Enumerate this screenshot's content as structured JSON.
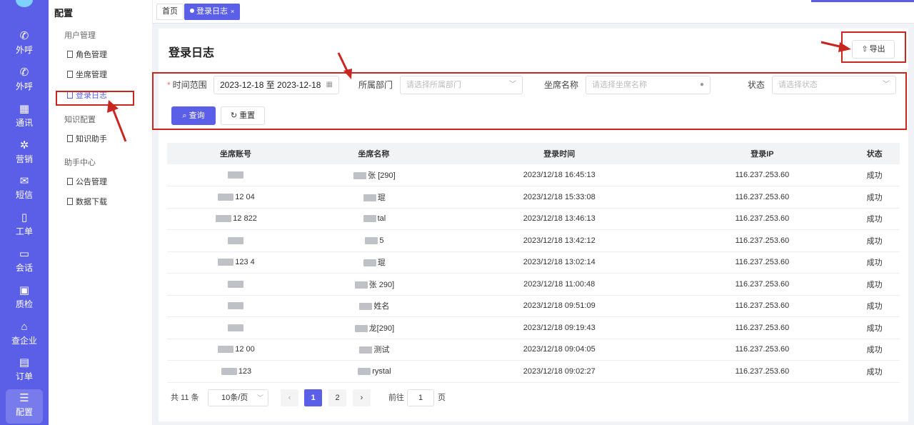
{
  "rail": {
    "items": [
      {
        "label": "外呼",
        "icon": "phone-outgoing-icon"
      },
      {
        "label": "外呼",
        "icon": "phone-outgoing-icon"
      },
      {
        "label": "通讯",
        "icon": "contacts-icon"
      },
      {
        "label": "营销",
        "icon": "marketing-icon"
      },
      {
        "label": "短信",
        "icon": "sms-icon"
      },
      {
        "label": "工单",
        "icon": "clipboard-icon"
      },
      {
        "label": "会话",
        "icon": "chat-icon"
      },
      {
        "label": "质检",
        "icon": "calendar-check-icon"
      },
      {
        "label": "查企业",
        "icon": "building-icon"
      },
      {
        "label": "订单",
        "icon": "order-icon"
      },
      {
        "label": "配置",
        "icon": "sliders-icon"
      }
    ]
  },
  "subnav": {
    "title": "配置",
    "groups": [
      {
        "label": "用户管理",
        "items": [
          "角色管理",
          "坐席管理",
          "登录日志"
        ]
      },
      {
        "label": "知识配置",
        "items": [
          "知识助手"
        ]
      },
      {
        "label": "助手中心",
        "items": [
          "公告管理",
          "数据下载"
        ]
      }
    ]
  },
  "tabs": {
    "home": "首页",
    "active": "登录日志",
    "close": "×"
  },
  "page": {
    "title": "登录日志",
    "export_label": "导出"
  },
  "filters": {
    "time_label": "时间范围",
    "time_value": "2023-12-18 至 2023-12-18",
    "dept_label": "所属部门",
    "dept_placeholder": "请选择所属部门",
    "seat_label": "坐席名称",
    "seat_placeholder": "请选择坐席名称",
    "status_label": "状态",
    "status_placeholder": "请选择状态",
    "search_label": "查询",
    "reset_label": "重置"
  },
  "table": {
    "headers": [
      "坐席账号",
      "坐席名称",
      "登录时间",
      "登录IP",
      "状态"
    ],
    "rows": [
      {
        "account": "",
        "name": "张 [290]",
        "time": "2023/12/18 16:45:13",
        "ip": "116.237.253.60",
        "status": "成功"
      },
      {
        "account": "12 04",
        "name": "琨",
        "time": "2023/12/18 15:33:08",
        "ip": "116.237.253.60",
        "status": "成功"
      },
      {
        "account": "12 822",
        "name": "tal",
        "time": "2023/12/18 13:46:13",
        "ip": "116.237.253.60",
        "status": "成功"
      },
      {
        "account": "",
        "name": "5",
        "time": "2023/12/18 13:42:12",
        "ip": "116.237.253.60",
        "status": "成功"
      },
      {
        "account": "123 4",
        "name": "琨",
        "time": "2023/12/18 13:02:14",
        "ip": "116.237.253.60",
        "status": "成功"
      },
      {
        "account": "",
        "name": "张 290]",
        "time": "2023/12/18 11:00:48",
        "ip": "116.237.253.60",
        "status": "成功"
      },
      {
        "account": "",
        "name": "姓名",
        "time": "2023/12/18 09:51:09",
        "ip": "116.237.253.60",
        "status": "成功"
      },
      {
        "account": "",
        "name": "龙[290]",
        "time": "2023/12/18 09:19:43",
        "ip": "116.237.253.60",
        "status": "成功"
      },
      {
        "account": "12 00",
        "name": "测试",
        "time": "2023/12/18 09:04:05",
        "ip": "116.237.253.60",
        "status": "成功"
      },
      {
        "account": "123",
        "name": "rystal",
        "time": "2023/12/18 09:02:27",
        "ip": "116.237.253.60",
        "status": "成功"
      }
    ]
  },
  "pagination": {
    "total": "共 11 条",
    "page_size": "10条/页",
    "pages": [
      "1",
      "2"
    ],
    "current_page": "1",
    "goto_label": "前往",
    "goto_value": "1",
    "goto_suffix": "页"
  },
  "colors": {
    "primary": "#5b5fe8",
    "annotation": "#c9261f"
  }
}
